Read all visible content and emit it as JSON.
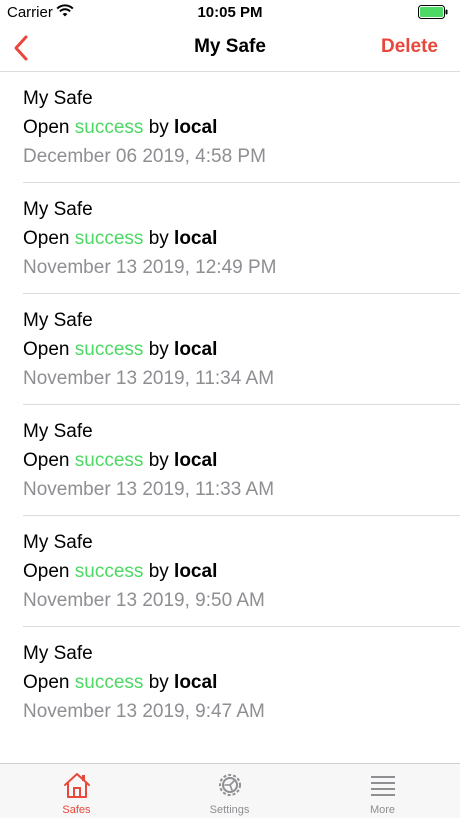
{
  "status_bar": {
    "carrier": "Carrier",
    "time": "10:05 PM"
  },
  "nav": {
    "title": "My Safe",
    "delete_label": "Delete",
    "accent_color": "#e8483c"
  },
  "log_entries": [
    {
      "safe": "My Safe",
      "action": "Open",
      "result": "success",
      "by_word": "by",
      "by_who": "local",
      "timestamp": "December 06 2019, 4:58 PM"
    },
    {
      "safe": "My Safe",
      "action": "Open",
      "result": "success",
      "by_word": "by",
      "by_who": "local",
      "timestamp": "November 13 2019, 12:49 PM"
    },
    {
      "safe": "My Safe",
      "action": "Open",
      "result": "success",
      "by_word": "by",
      "by_who": "local",
      "timestamp": "November 13 2019, 11:34 AM"
    },
    {
      "safe": "My Safe",
      "action": "Open",
      "result": "success",
      "by_word": "by",
      "by_who": "local",
      "timestamp": "November 13 2019, 11:33 AM"
    },
    {
      "safe": "My Safe",
      "action": "Open",
      "result": "success",
      "by_word": "by",
      "by_who": "local",
      "timestamp": "November 13 2019, 9:50 AM"
    },
    {
      "safe": "My Safe",
      "action": "Open",
      "result": "success",
      "by_word": "by",
      "by_who": "local",
      "timestamp": "November 13 2019, 9:47 AM"
    }
  ],
  "tab_bar": {
    "items": [
      {
        "label": "Safes",
        "icon": "house-icon",
        "active": true
      },
      {
        "label": "Settings",
        "icon": "gear-icon",
        "active": false
      },
      {
        "label": "More",
        "icon": "menu-lines-icon",
        "active": false
      }
    ]
  },
  "colors": {
    "success": "#4cd964",
    "timestamp": "#8e8e93",
    "inactive_tab": "#8e8e93"
  }
}
